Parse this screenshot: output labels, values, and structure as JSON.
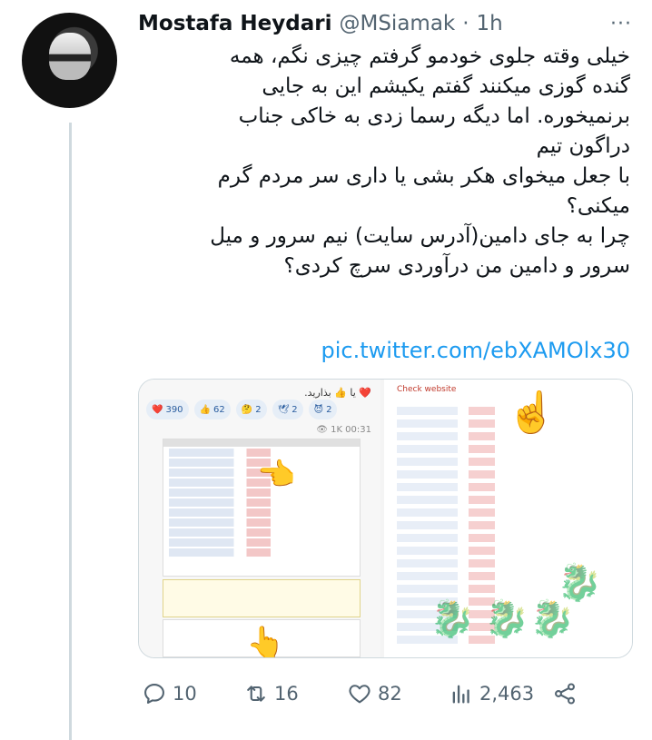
{
  "author": {
    "name": "Mostafa Heydari",
    "handle": "@MSiamak",
    "separator": "·",
    "time": "1h"
  },
  "more_label": "···",
  "tweet": {
    "text": "خیلی وقته جلوی خودمو گرفتم چیزی نگم، همه\nگنده گوزی میکنند گفتم یکیشم این به جایی\nبرنمیخوره. اما دیگه رسما زدی به خاکی جناب\nدراگون تیم\nبا جعل میخوای هکر بشی یا داری سر مردم گرم\nمیکنی؟\nچرا به جای دامین(آدرس سایت) نیم سرور و میل\nسرور و دامین من درآوردی سرچ کردی؟",
    "link": "pic.twitter.com/ebXAMOlx30"
  },
  "media": {
    "left_caption": "❤️ یا 👍 بذارید.",
    "reactions": [
      {
        "icon": "❤️",
        "count": "390"
      },
      {
        "icon": "👍",
        "count": "62"
      },
      {
        "icon": "🤔",
        "count": "2"
      },
      {
        "icon": "🕊",
        "count": "2"
      },
      {
        "icon": "😈",
        "count": "2"
      }
    ],
    "views": "👁 1K 00:31",
    "right_header": "Check website"
  },
  "actions": {
    "replies": "10",
    "retweets": "16",
    "likes": "82",
    "views": "2,463"
  },
  "colors": {
    "link": "#1d9bf0",
    "secondary_text": "#536471",
    "thread_line": "#cfd9de"
  }
}
